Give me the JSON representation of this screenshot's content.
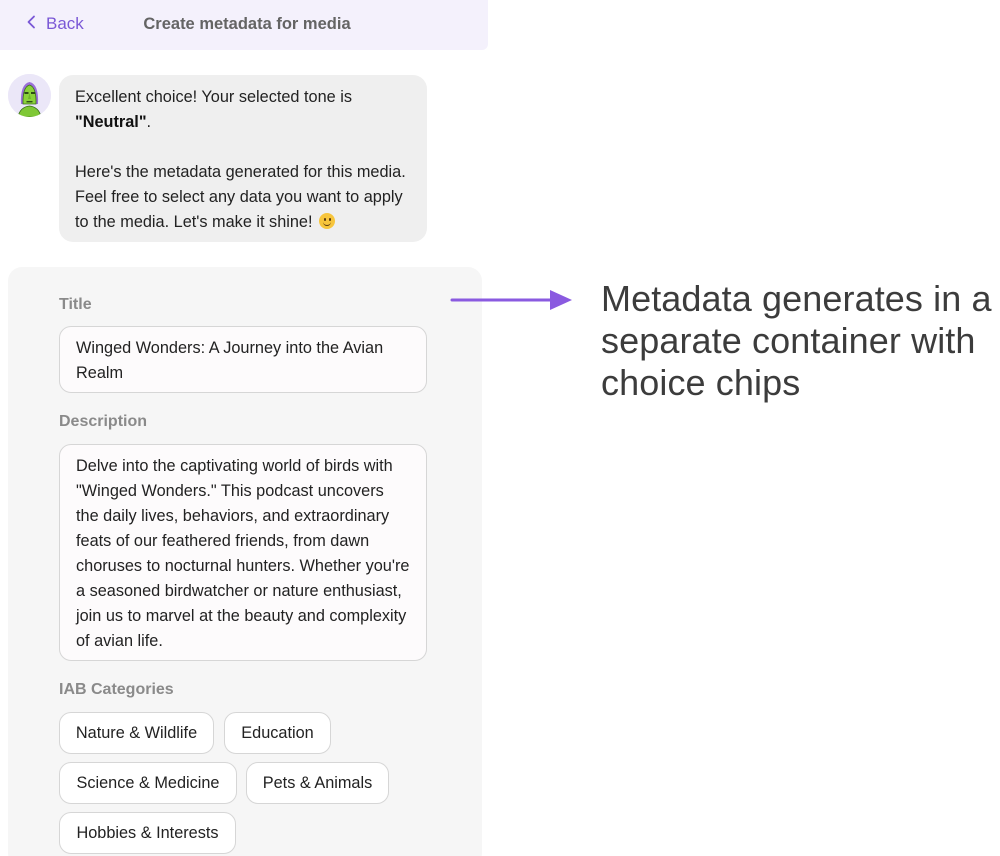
{
  "header": {
    "back_label": "Back",
    "title": "Create metadata for media"
  },
  "chat": {
    "line1_prefix": "Excellent choice! Your selected tone is",
    "tone": "\"Neutral\"",
    "line1_suffix": ".",
    "line2": "Here's the metadata generated for this media. Feel free to select any data you want to apply to the media. Let's make it shine!",
    "emoji_icon": "smiling-face-icon"
  },
  "metadata": {
    "title_label": "Title",
    "title_value": "Winged Wonders: A Journey into the Avian Realm",
    "description_label": "Description",
    "description_value": "Delve into the captivating world of birds with \"Winged Wonders.\" This podcast uncovers the daily lives, behaviors, and extraordinary feats of our feathered friends, from dawn choruses to nocturnal hunters. Whether you're a seasoned birdwatcher or nature enthusiast, join us to marvel at the beauty and complexity of avian life.",
    "categories_label": "IAB Categories",
    "categories": [
      "Nature & Wildlife",
      "Education",
      "Science & Medicine",
      "Pets & Animals",
      "Hobbies & Interests"
    ]
  },
  "annotation": {
    "text": "Metadata generates in a separate container with choice chips"
  },
  "colors": {
    "accent": "#7a58d6",
    "header_bg": "#f4f1fc",
    "bubble_bg": "#efefef",
    "panel_bg": "#f6f6f6",
    "arrow": "#8a5ae0"
  }
}
